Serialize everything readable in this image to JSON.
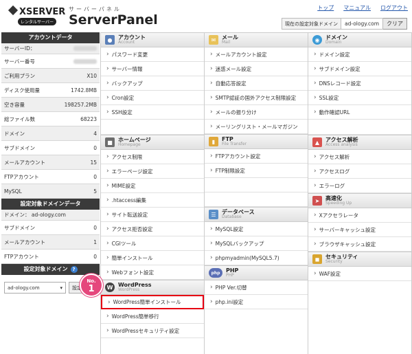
{
  "header": {
    "brand": "XSERVER",
    "badge": "レンタルサーバー",
    "kana": "サーバーパネル",
    "panel": "ServerPanel",
    "links": [
      "トップ",
      "マニュアル",
      "ログアウト"
    ],
    "domain_label": "現在の設定対象ドメイン",
    "domain_value": "ad-ology.com",
    "clear_label": "クリア"
  },
  "sidebar": {
    "account_title": "アカウントデータ",
    "server_id_label": "サーバーID：",
    "rows": [
      {
        "k": "サーバー番号",
        "v": ""
      },
      {
        "k": "ご利用プラン",
        "v": "X10"
      },
      {
        "k": "ディスク使用量",
        "v": "1742.8MB"
      },
      {
        "k": "空き容量",
        "v": "198257.2MB"
      },
      {
        "k": "総ファイル数",
        "v": "68223"
      },
      {
        "k": "ドメイン",
        "v": "4"
      },
      {
        "k": "サブドメイン",
        "v": "0"
      },
      {
        "k": "メールアカウント",
        "v": "15"
      },
      {
        "k": "FTPアカウント",
        "v": "0"
      },
      {
        "k": "MySQL",
        "v": "5"
      }
    ],
    "domain_data_title": "設定対象ドメインデータ",
    "domain_line": "ドメイン： ad-ology.com",
    "domain_rows": [
      {
        "k": "サブドメイン",
        "v": "0"
      },
      {
        "k": "メールアカウント",
        "v": "1"
      },
      {
        "k": "FTPアカウント",
        "v": "0"
      }
    ],
    "target_title": "設定対象ドメイン",
    "select_value": "ad-ology.com",
    "set_btn": "設定"
  },
  "sections": {
    "account": {
      "jp": "アカウント",
      "en": "Account",
      "items": [
        "パスワード変更",
        "サーバー情報",
        "バックアップ",
        "Cron設定",
        "SSH設定"
      ]
    },
    "homepage": {
      "jp": "ホームページ",
      "en": "Homepage",
      "items": [
        "アクセス制限",
        "エラーページ設定",
        "MIME設定",
        ".htaccess編集",
        "サイト転送設定",
        "アクセス拒否設定",
        "CGIツール",
        "簡単インストール",
        "Webフォント設定"
      ]
    },
    "wordpress": {
      "jp": "WordPress",
      "en": "WordPress",
      "items": [
        "WordPress簡単インストール",
        "WordPress簡単移行",
        "WordPressセキュリティ設定"
      ]
    },
    "mail": {
      "jp": "メール",
      "en": "Mail",
      "items": [
        "メールアカウント設定",
        "迷惑メール設定",
        "自動応答設定",
        "SMTP認証の国外アクセス制限設定",
        "メールの振り分け",
        "メーリングリスト・メールマガジン"
      ]
    },
    "ftp": {
      "jp": "FTP",
      "en": "File Transfer",
      "items": [
        "FTPアカウント設定",
        "FTP制限設定"
      ]
    },
    "database": {
      "jp": "データベース",
      "en": "Database",
      "items": [
        "MySQL設定",
        "MySQLバックアップ",
        "phpmyadmin(MySQL5.7)"
      ]
    },
    "php": {
      "jp": "PHP",
      "en": "PHP",
      "items": [
        "PHP Ver.切替",
        "php.ini設定"
      ]
    },
    "domain": {
      "jp": "ドメイン",
      "en": "Domain",
      "items": [
        "ドメイン設定",
        "サブドメイン設定",
        "DNSレコード設定",
        "SSL設定",
        "動作確認URL"
      ]
    },
    "access": {
      "jp": "アクセス解析",
      "en": "Access analysis",
      "items": [
        "アクセス解析",
        "アクセスログ",
        "エラーログ"
      ]
    },
    "speed": {
      "jp": "高速化",
      "en": "Speeding Up",
      "items": [
        "Xアクセラレータ",
        "サーバーキャッシュ設定",
        "ブラウザキャッシュ設定"
      ]
    },
    "security": {
      "jp": "セキュリティ",
      "en": "Security",
      "items": [
        "WAF設定"
      ]
    }
  },
  "badge": {
    "no": "No.",
    "num": "1"
  },
  "colors": {
    "highlight": "#e60012",
    "badge": "#e5477c"
  }
}
